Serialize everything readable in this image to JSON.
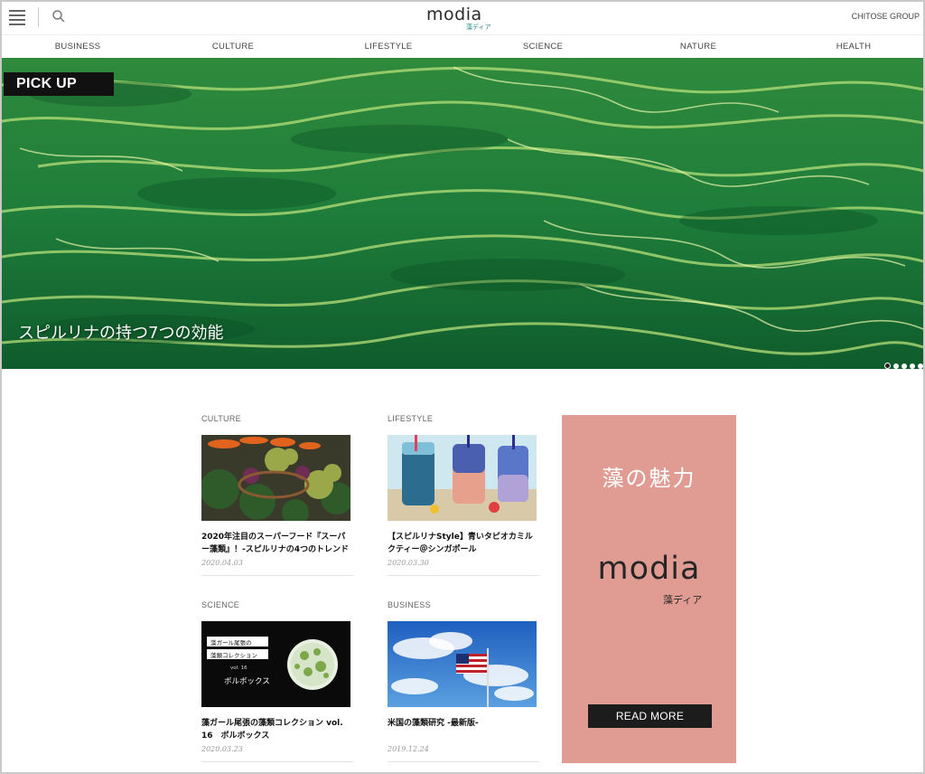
{
  "header": {
    "logo_text": "modia",
    "logo_subtext": "藻ディア",
    "group_link": "CHITOSE GROUP",
    "menu_icon": "hamburger-menu-icon",
    "search_icon": "search-icon"
  },
  "nav": {
    "categories": [
      "BUSINESS",
      "CULTURE",
      "LIFESTYLE",
      "SCIENCE",
      "NATURE",
      "HEALTH"
    ]
  },
  "hero": {
    "badge": "PICK UP",
    "title": "スピルリナの持つ7つの効能",
    "slide_count": 5,
    "active_slide": 1
  },
  "articles": [
    {
      "category": "CULTURE",
      "title": "2020年注目のスーパーフード『スーパー藻類』！-スピルリナの4つのトレンドポ",
      "date": "2020.04.03"
    },
    {
      "category": "LIFESTYLE",
      "title": "【スピルリナStyle】青いタピオカミルクティー＠シンガポール",
      "date": "2020.03.30"
    },
    {
      "category": "SCIENCE",
      "title": "藻ガール尾張の藻類コレクション vol. 16　ボルボックス",
      "date": "2020.03.23",
      "thumb_lines": [
        "藻ガール尾張の",
        "藻類コレクション",
        "vol. 16",
        "ボルボックス"
      ]
    },
    {
      "category": "BUSINESS",
      "title": "米国の藻類研究 -最新版-",
      "date": "2019.12.24"
    }
  ],
  "banner": {
    "headline": "藻の魅力",
    "logo_text": "modia",
    "logo_subtext": "藻ディア",
    "button_label": "READ MORE",
    "background_color": "#e09c92"
  }
}
